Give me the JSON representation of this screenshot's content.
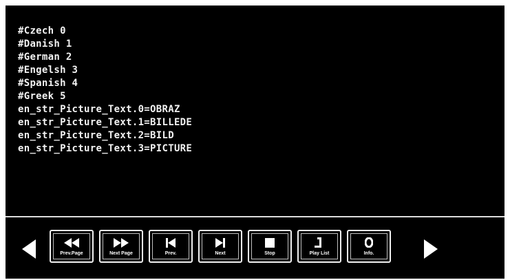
{
  "text_lines": [
    "#Czech 0",
    "#Danish 1",
    "#German 2",
    "#Engelsh 3",
    "#Spanish 4",
    "#Greek 5",
    "en_str_Picture_Text.0=OBRAZ",
    "en_str_Picture_Text.1=BILLEDE",
    "en_str_Picture_Text.2=BILD",
    "en_str_Picture_Text.3=PICTURE"
  ],
  "controls": [
    {
      "label": "Prev.Page",
      "icon": "rewind-icon"
    },
    {
      "label": "Next Page",
      "icon": "fast-forward-icon"
    },
    {
      "label": "Prev.",
      "icon": "skip-back-icon"
    },
    {
      "label": "Next",
      "icon": "skip-forward-icon"
    },
    {
      "label": "Stop",
      "icon": "stop-icon"
    },
    {
      "label": "Play List",
      "icon": "playlist-icon"
    },
    {
      "label": "Info.",
      "icon": "info-icon"
    }
  ],
  "navigation": {
    "left": "left-arrow-icon",
    "right": "right-arrow-icon"
  },
  "colors": {
    "background": "#000000",
    "text": "#f2f2f2",
    "border": "#f0f0f0",
    "frame": "#ffffff"
  }
}
